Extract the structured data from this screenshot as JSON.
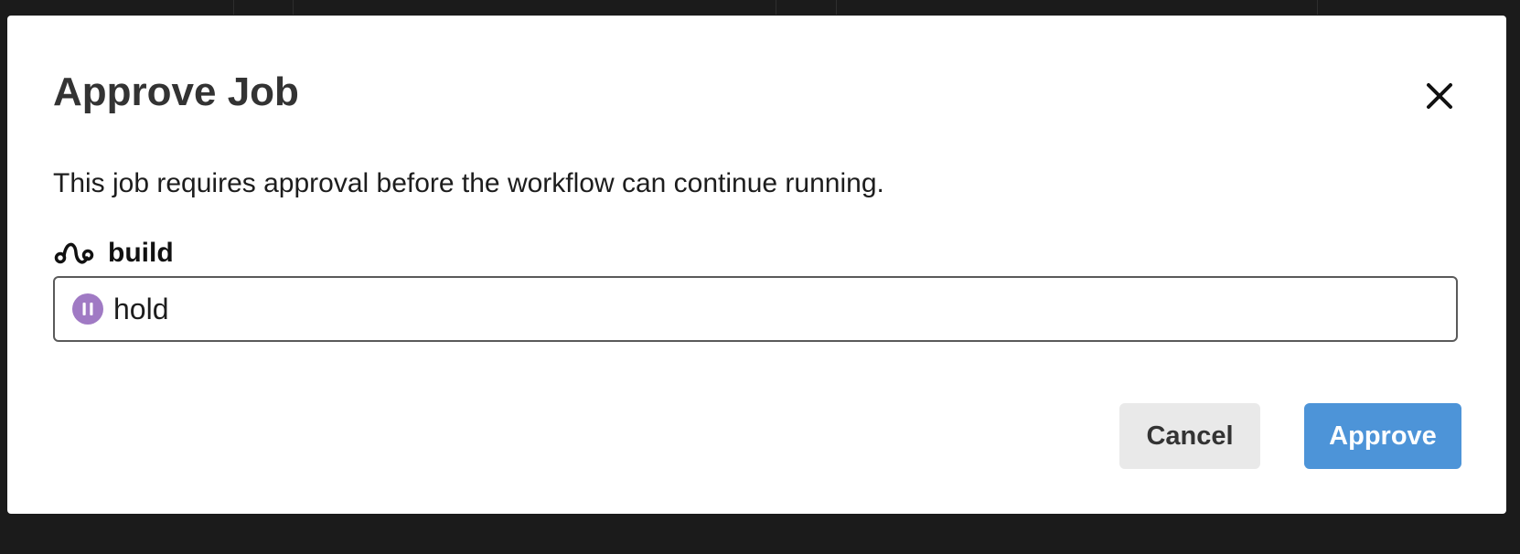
{
  "dialog": {
    "title": "Approve Job",
    "description": "This job requires approval before the workflow can continue running.",
    "job": {
      "name": "build",
      "icon": "workflow-icon"
    },
    "field": {
      "status_icon": "pause-icon",
      "value": "hold"
    },
    "buttons": {
      "cancel_label": "Cancel",
      "approve_label": "Approve"
    },
    "close_icon": "close-icon"
  },
  "colors": {
    "backdrop": "#1b1b1b",
    "modal_background": "#ffffff",
    "title_text": "#333333",
    "hold_badge": "#a07ac4",
    "cancel_button": "#e9e9e9",
    "approve_button": "#4d94d8",
    "approve_text": "#ffffff"
  }
}
